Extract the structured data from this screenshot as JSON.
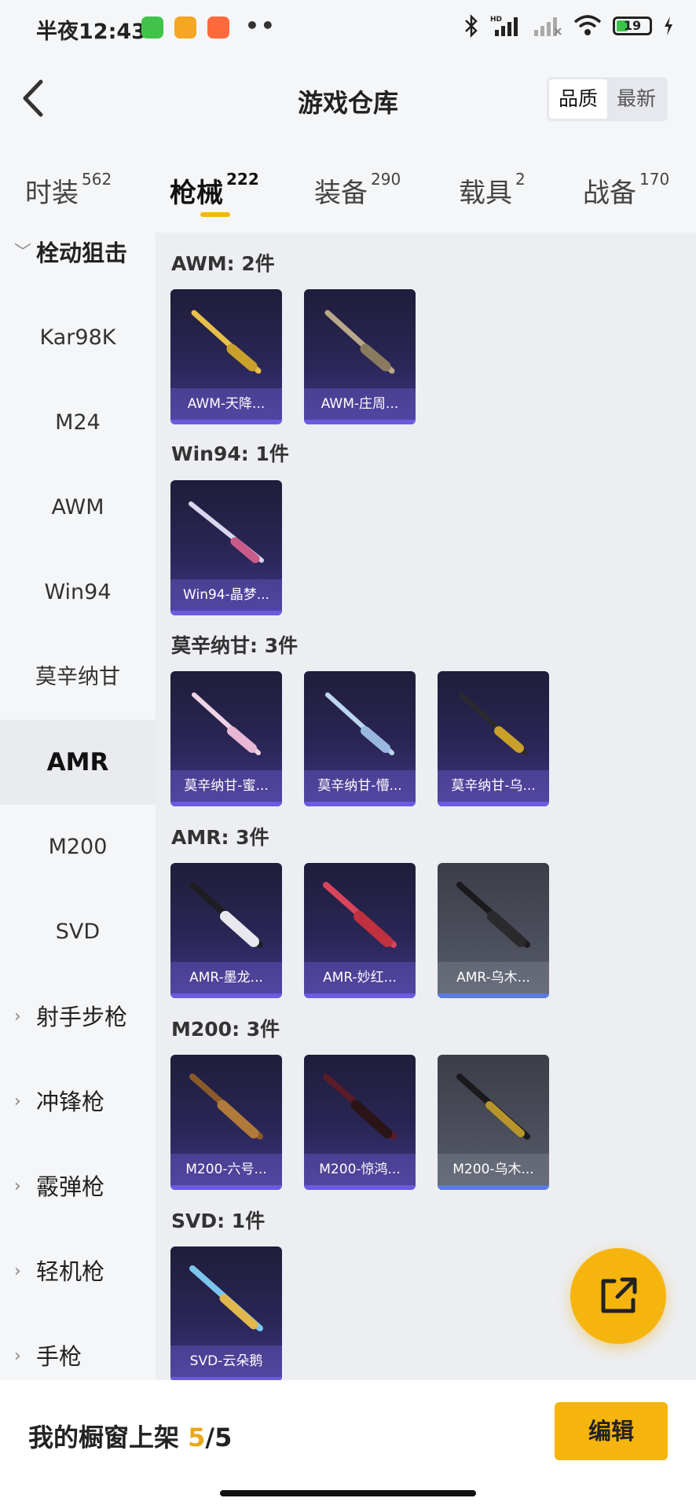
{
  "status_bar": {
    "time": "半夜12:43",
    "battery": "19"
  },
  "header": {
    "title": "游戏仓库",
    "sort_quality": "品质",
    "sort_latest": "最新"
  },
  "tabs": [
    {
      "label": "时装",
      "count": "562"
    },
    {
      "label": "枪械",
      "count": "222"
    },
    {
      "label": "装备",
      "count": "290"
    },
    {
      "label": "载具",
      "count": "2"
    },
    {
      "label": "战备",
      "count": "170"
    }
  ],
  "sidebar": {
    "group_open": "栓动狙击",
    "items": [
      "Kar98K",
      "M24",
      "AWM",
      "Win94",
      "莫辛纳甘",
      "AMR",
      "M200",
      "SVD"
    ],
    "groups": [
      "射手步枪",
      "冲锋枪",
      "霰弹枪",
      "轻机枪",
      "手枪"
    ]
  },
  "sections": [
    {
      "title": "AWM: 2件",
      "items": [
        "AWM-天降...",
        "AWM-庄周..."
      ]
    },
    {
      "title": "Win94: 1件",
      "items": [
        "Win94-晶梦..."
      ]
    },
    {
      "title": "莫辛纳甘: 3件",
      "items": [
        "莫辛纳甘-蜜...",
        "莫辛纳甘-懵...",
        "莫辛纳甘-乌..."
      ]
    },
    {
      "title": "AMR: 3件",
      "items": [
        "AMR-墨龙...",
        "AMR-妙红...",
        "AMR-乌木..."
      ]
    },
    {
      "title": "M200: 3件",
      "items": [
        "M200-六号...",
        "M200-惊鸿...",
        "M200-乌木..."
      ]
    },
    {
      "title": "SVD: 1件",
      "items": [
        "SVD-云朵鹅"
      ]
    }
  ],
  "footer": {
    "label": "我的橱窗上架",
    "count": "5",
    "total": "/5",
    "edit": "编辑"
  },
  "icons": {
    "back": "chevron-left-icon",
    "fab": "share-external-icon"
  },
  "colors": {
    "accent": "#f6b40e",
    "card_purple": "#2a2656",
    "card_grey": "#4c4f5c"
  }
}
